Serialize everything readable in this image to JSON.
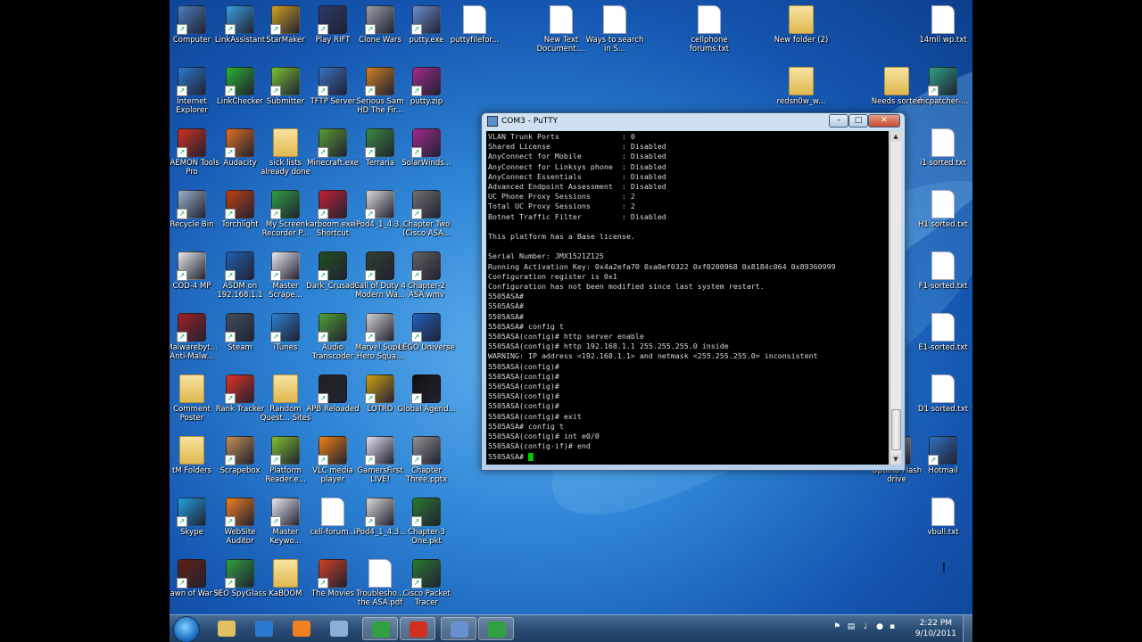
{
  "desktop": {
    "icons": [
      {
        "label": "Computer",
        "color": "#4a7fc0",
        "type": "exe"
      },
      {
        "label": "LinkAssistant",
        "color": "#3aa0e0",
        "type": "exe"
      },
      {
        "label": "StarMaker",
        "color": "#d0a020",
        "type": "exe"
      },
      {
        "label": "Play RIFT",
        "color": "#2b3a6a",
        "type": "exe"
      },
      {
        "label": "Clone Wars",
        "color": "#9aa0a8",
        "type": "exe"
      },
      {
        "label": "putty.exe",
        "color": "#6a8fd0",
        "type": "exe"
      },
      {
        "label": "puttyfilefor...",
        "color": "#ffffff",
        "type": "doc"
      },
      {
        "label": "New Text Document....",
        "color": "#ffffff",
        "type": "doc"
      },
      {
        "label": "Ways to search in S...",
        "color": "#ffffff",
        "type": "doc"
      },
      {
        "label": "cellphone forums.txt",
        "color": "#ffffff",
        "type": "doc"
      },
      {
        "label": "New folder (2)",
        "color": "#f0d080",
        "type": "folder"
      },
      {
        "label": "14mil wp.txt",
        "color": "#ffffff",
        "type": "doc"
      },
      {
        "label": "Internet Explorer",
        "color": "#2a7ad0",
        "type": "exe"
      },
      {
        "label": "LinkChecker",
        "color": "#2bb030",
        "type": "exe"
      },
      {
        "label": "Submitter",
        "color": "#7ac030",
        "type": "exe"
      },
      {
        "label": "TFTP Server",
        "color": "#3a70c0",
        "type": "exe"
      },
      {
        "label": "Serious Sam HD The Fir...",
        "color": "#d08020",
        "type": "exe"
      },
      {
        "label": "putty.zip",
        "color": "#a02a8a",
        "type": "exe"
      },
      {
        "label": "redsn0w_w...",
        "color": "#f0d080",
        "type": "folder"
      },
      {
        "label": "Needs sorted",
        "color": "#f0d080",
        "type": "folder"
      },
      {
        "label": "mcpatcher-...",
        "color": "#30a080",
        "type": "exe"
      },
      {
        "label": "DAEMON Tools Pro",
        "color": "#d03020",
        "type": "exe"
      },
      {
        "label": "Audacity",
        "color": "#e07020",
        "type": "exe"
      },
      {
        "label": "sick lists already done",
        "color": "#f0d080",
        "type": "folder"
      },
      {
        "label": "Minecraft.exe",
        "color": "#5a9a30",
        "type": "exe"
      },
      {
        "label": "Terraria",
        "color": "#3a8a40",
        "type": "exe"
      },
      {
        "label": "SolarWinds...",
        "color": "#a02a8a",
        "type": "exe"
      },
      {
        "label": "i1 sorted.txt",
        "color": "#ffffff",
        "type": "doc"
      },
      {
        "label": "Recycle Bin",
        "color": "#9ab0c8",
        "type": "exe"
      },
      {
        "label": "Torchlight",
        "color": "#c04010",
        "type": "exe"
      },
      {
        "label": "My Screen Recorder P...",
        "color": "#30a040",
        "type": "exe"
      },
      {
        "label": "karboom.exe - Shortcut",
        "color": "#c02030",
        "type": "exe"
      },
      {
        "label": "iPod4_1_4.3...",
        "color": "#d8d8d8",
        "type": "exe"
      },
      {
        "label": "Chapter Two (Cisco ASA...",
        "color": "#707070",
        "type": "exe"
      },
      {
        "label": "H1 sorted.txt",
        "color": "#ffffff",
        "type": "doc"
      },
      {
        "label": "COD-4 MP",
        "color": "#e8e8e8",
        "type": "exe"
      },
      {
        "label": "ASDM on 192.168.1.1",
        "color": "#2060b0",
        "type": "exe"
      },
      {
        "label": "Master Scrape...",
        "color": "#e8e8f0",
        "type": "exe"
      },
      {
        "label": "Dark_Crusade",
        "color": "#205020",
        "type": "exe"
      },
      {
        "label": "Call of Duty 4 Modern Wa...",
        "color": "#304030",
        "type": "exe"
      },
      {
        "label": "Chapter-2 ASA.wmv",
        "color": "#606060",
        "type": "exe"
      },
      {
        "label": "F1-sorted.txt",
        "color": "#ffffff",
        "type": "doc"
      },
      {
        "label": "Malwarebyt... Anti-Malw...",
        "color": "#a02020",
        "type": "exe"
      },
      {
        "label": "Steam",
        "color": "#40505a",
        "type": "exe"
      },
      {
        "label": "iTunes",
        "color": "#2a80d0",
        "type": "exe"
      },
      {
        "label": "Audio Transcoder",
        "color": "#50a030",
        "type": "exe"
      },
      {
        "label": "Marvel Super Hero Squa...",
        "color": "#d0d0d0",
        "type": "exe"
      },
      {
        "label": "LEGO Universe",
        "color": "#2060c0",
        "type": "exe"
      },
      {
        "label": "E1-sorted.txt",
        "color": "#ffffff",
        "type": "doc"
      },
      {
        "label": "Comment Poster",
        "color": "#f0d080",
        "type": "folder"
      },
      {
        "label": "Rank Tracker",
        "color": "#e03020",
        "type": "exe"
      },
      {
        "label": "Random Quest... Sites",
        "color": "#f0d080",
        "type": "folder"
      },
      {
        "label": "APB Reloaded",
        "color": "#202020",
        "type": "exe"
      },
      {
        "label": "LOTRO",
        "color": "#d0a010",
        "type": "exe"
      },
      {
        "label": "Global Agend...",
        "color": "#101010",
        "type": "exe"
      },
      {
        "label": "D1 sorted.txt",
        "color": "#ffffff",
        "type": "doc"
      },
      {
        "label": "tM Folders",
        "color": "#f0d080",
        "type": "folder"
      },
      {
        "label": "Scrapebox",
        "color": "#c09050",
        "type": "exe"
      },
      {
        "label": "Platform Reader.e...",
        "color": "#80c030",
        "type": "exe"
      },
      {
        "label": "VLC media player",
        "color": "#f08010",
        "type": "exe"
      },
      {
        "label": "GamersFirst LIVE!",
        "color": "#e0e0f0",
        "type": "exe"
      },
      {
        "label": "Chapter Three.pptx",
        "color": "#909090",
        "type": "exe"
      },
      {
        "label": "Optima Flash drive",
        "color": "#c0c0c0",
        "type": "exe"
      },
      {
        "label": "Hotmail",
        "color": "#3070c0",
        "type": "exe"
      },
      {
        "label": "Skype",
        "color": "#20a0e0",
        "type": "exe"
      },
      {
        "label": "WebSite Auditor",
        "color": "#f08020",
        "type": "exe"
      },
      {
        "label": "Master Keywo...",
        "color": "#e8e8f0",
        "type": "exe"
      },
      {
        "label": "cell-forum...",
        "color": "#ffffff",
        "type": "doc"
      },
      {
        "label": "iPod4_1_4.3...",
        "color": "#d8d8d8",
        "type": "exe"
      },
      {
        "label": "Chapter-3 One.pkt",
        "color": "#2a7a30",
        "type": "exe"
      },
      {
        "label": "vbull.txt",
        "color": "#ffffff",
        "type": "doc"
      },
      {
        "label": "Dawn of War II",
        "color": "#602010",
        "type": "exe"
      },
      {
        "label": "SEO SpyGlass",
        "color": "#30a040",
        "type": "exe"
      },
      {
        "label": "KaBOOM",
        "color": "#f0d080",
        "type": "folder"
      },
      {
        "label": "The Movies",
        "color": "#d04020",
        "type": "exe"
      },
      {
        "label": "Troublesho... the ASA.pdf",
        "color": "#ffffff",
        "type": "doc"
      },
      {
        "label": "Cisco Packet Tracer",
        "color": "#2a7a30",
        "type": "exe"
      }
    ]
  },
  "putty": {
    "title": "COM3 - PuTTY",
    "lines": [
      "VLAN Trunk Ports              : 0",
      "Shared License                : Disabled",
      "AnyConnect for Mobile         : Disabled",
      "AnyConnect for Linksys phone  : Disabled",
      "AnyConnect Essentials         : Disabled",
      "Advanced Endpoint Assessment  : Disabled",
      "UC Phone Proxy Sessions       : 2",
      "Total UC Proxy Sessions       : 2",
      "Botnet Traffic Filter         : Disabled",
      "",
      "This platform has a Base license.",
      "",
      "Serial Number: JMX1521Z125",
      "Running Activation Key: 0x4a2efa70 0xa0ef0322 0xf0200968 0x8184c064 0x89360999",
      "Configuration register is 0x1",
      "Configuration has not been modified since last system restart.",
      "5505ASA#",
      "5505ASA#",
      "5505ASA#",
      "5505ASA# config t",
      "5505ASA(config)# http server enable",
      "5505ASA(config)# http 192.168.1.1 255.255.255.0 inside",
      "WARNING: IP address <192.168.1.1> and netmask <255.255.255.0> inconsistent",
      "5505ASA(config)#",
      "5505ASA(config)#",
      "5505ASA(config)#",
      "5505ASA(config)#",
      "5505ASA(config)#",
      "5505ASA(config)# exit",
      "5505ASA# config t",
      "5505ASA(config)# int e0/0",
      "5505ASA(config-if)# end"
    ],
    "prompt": "5505ASA# "
  },
  "taskbar": {
    "pinned": [
      {
        "name": "explorer",
        "color": "#e0c060"
      },
      {
        "name": "internet-explorer",
        "color": "#2a7ad0"
      },
      {
        "name": "media-player",
        "color": "#f08020"
      },
      {
        "name": "notes",
        "color": "#8ab0d8"
      },
      {
        "name": "active-app-1",
        "color": "#30a040"
      },
      {
        "name": "active-app-2",
        "color": "#d03020"
      },
      {
        "name": "putty",
        "color": "#6a8fd0"
      },
      {
        "name": "active-app-3",
        "color": "#30a040"
      }
    ],
    "time": "2:22 PM",
    "date": "9/10/2011"
  }
}
